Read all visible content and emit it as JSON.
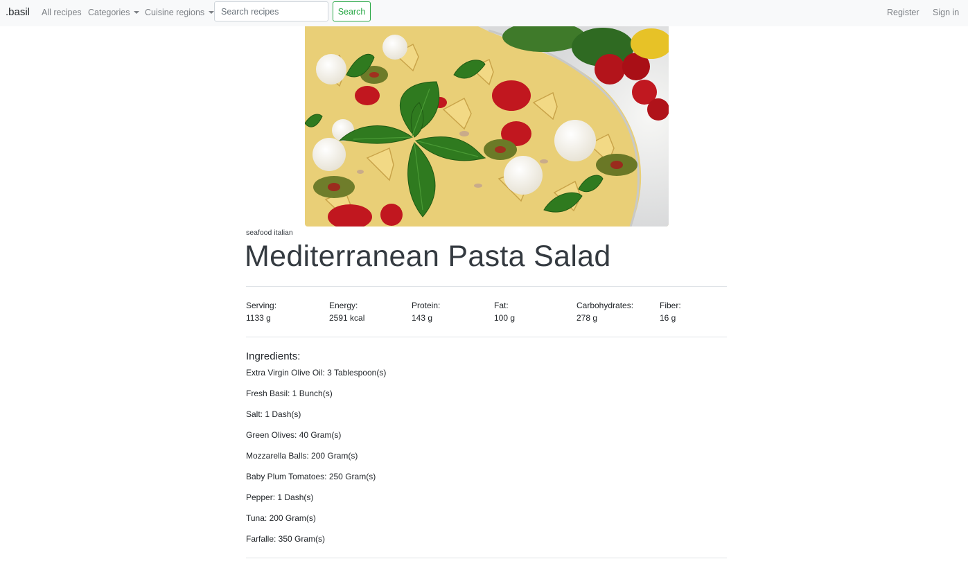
{
  "navbar": {
    "brand": ".basil",
    "links": {
      "all_recipes": "All recipes",
      "categories": "Categories",
      "cuisine_regions": "Cuisine regions"
    },
    "search": {
      "placeholder": "Search recipes",
      "value": "",
      "button_label": "Search"
    },
    "register": "Register",
    "sign_in": "Sign in"
  },
  "colors": {
    "navbar_bg": "#f8f9fa",
    "search_accent": "#28a745",
    "text": "#212529",
    "divider": "#dee2e6"
  },
  "recipe": {
    "tags": "seafood italian",
    "title": "Mediterranean Pasta Salad",
    "nutrition": [
      {
        "label": "Serving:",
        "value": "1133 g"
      },
      {
        "label": "Energy:",
        "value": "2591 kcal"
      },
      {
        "label": "Protein:",
        "value": "143 g"
      },
      {
        "label": "Fat:",
        "value": "100 g"
      },
      {
        "label": "Carbohydrates:",
        "value": "278 g"
      },
      {
        "label": "Fiber:",
        "value": "16 g"
      }
    ],
    "ingredients_heading": "Ingredients:",
    "ingredients": [
      "Extra Virgin Olive Oil: 3 Tablespoon(s)",
      "Fresh Basil: 1 Bunch(s)",
      "Salt: 1 Dash(s)",
      "Green Olives: 40 Gram(s)",
      "Mozzarella Balls: 200 Gram(s)",
      "Baby Plum Tomatoes: 250 Gram(s)",
      "Pepper: 1 Dash(s)",
      "Tuna: 200 Gram(s)",
      "Farfalle: 350 Gram(s)"
    ]
  }
}
